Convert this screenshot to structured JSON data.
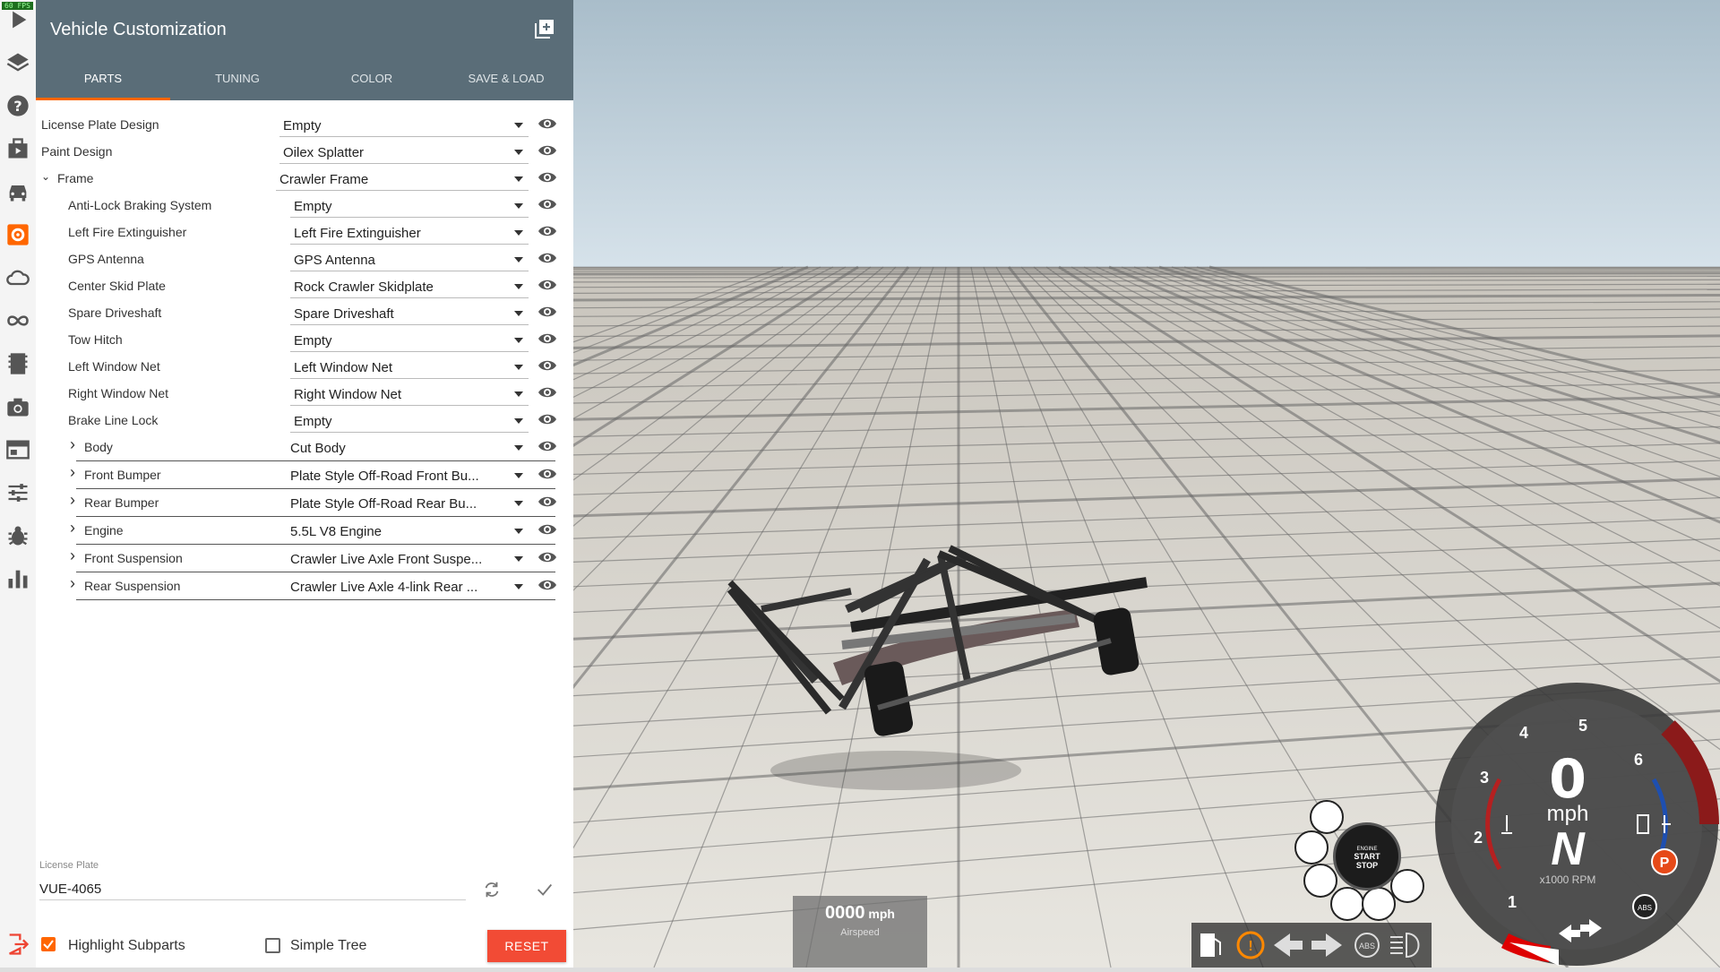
{
  "fps": "60 FPS",
  "panel": {
    "title": "Vehicle Customization",
    "tabs": [
      "PARTS",
      "TUNING",
      "COLOR",
      "SAVE & LOAD"
    ],
    "active_tab": "PARTS"
  },
  "parts": [
    {
      "label": "License Plate Design",
      "value": "Empty",
      "level": 0,
      "chevron": ""
    },
    {
      "label": "Paint Design",
      "value": "Oilex Splatter",
      "level": 0,
      "chevron": ""
    },
    {
      "label": "Frame",
      "value": "Crawler Frame",
      "level": 0,
      "chevron": "down"
    },
    {
      "label": "Anti-Lock Braking System",
      "value": "Empty",
      "level": 1,
      "chevron": ""
    },
    {
      "label": "Left Fire Extinguisher",
      "value": "Left Fire Extinguisher",
      "level": 1,
      "chevron": ""
    },
    {
      "label": "GPS Antenna",
      "value": "GPS Antenna",
      "level": 1,
      "chevron": ""
    },
    {
      "label": "Center Skid Plate",
      "value": "Rock Crawler Skidplate",
      "level": 1,
      "chevron": ""
    },
    {
      "label": "Spare Driveshaft",
      "value": "Spare Driveshaft",
      "level": 1,
      "chevron": ""
    },
    {
      "label": "Tow Hitch",
      "value": "Empty",
      "level": 1,
      "chevron": ""
    },
    {
      "label": "Left Window Net",
      "value": "Left Window Net",
      "level": 1,
      "chevron": ""
    },
    {
      "label": "Right Window Net",
      "value": "Right Window Net",
      "level": 1,
      "chevron": ""
    },
    {
      "label": "Brake Line Lock",
      "value": "Empty",
      "level": 1,
      "chevron": ""
    },
    {
      "label": "Body",
      "value": "Cut Body",
      "level": 1,
      "chevron": "right"
    },
    {
      "label": "Front Bumper",
      "value": "Plate Style Off-Road Front Bu...",
      "level": 1,
      "chevron": "right"
    },
    {
      "label": "Rear Bumper",
      "value": "Plate Style Off-Road Rear Bu...",
      "level": 1,
      "chevron": "right"
    },
    {
      "label": "Engine",
      "value": "5.5L V8 Engine",
      "level": 1,
      "chevron": "right"
    },
    {
      "label": "Front Suspension",
      "value": "Crawler Live Axle Front Suspe...",
      "level": 1,
      "chevron": "right"
    },
    {
      "label": "Rear Suspension",
      "value": "Crawler Live Axle 4-link Rear ...",
      "level": 1,
      "chevron": "right"
    }
  ],
  "license_plate": {
    "label": "License Plate",
    "value": "VUE-4065"
  },
  "options": {
    "highlight_subparts": {
      "label": "Highlight Subparts",
      "checked": true
    },
    "simple_tree": {
      "label": "Simple Tree",
      "checked": false
    },
    "reset_label": "RESET"
  },
  "hud": {
    "airspeed_value": "0000",
    "airspeed_unit": "mph",
    "airspeed_label": "Airspeed",
    "engine_label_1": "ENGINE",
    "engine_label_2": "START",
    "engine_label_3": "STOP",
    "speed": "0",
    "speed_unit": "mph",
    "gear": "N",
    "rpm_label": "x1000 RPM",
    "tach_numbers": [
      "1",
      "2",
      "3",
      "4",
      "5",
      "6"
    ],
    "parking_label": "P",
    "abs_label": "ABS"
  },
  "colors": {
    "header": "#5a6d78",
    "accent": "#ff6600",
    "reset": "#f24b35",
    "redline": "#8b1a1a",
    "blue_arc": "#1e4fb0"
  }
}
